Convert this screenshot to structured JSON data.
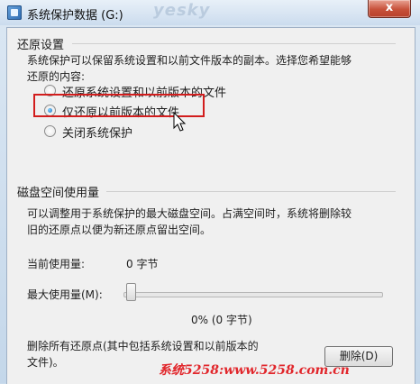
{
  "window": {
    "title": "系统保护数据 (G:)",
    "watermark": "yesky",
    "close_label": "x"
  },
  "restore_settings": {
    "heading": "还原设置",
    "description_lines": [
      "系统保护可以保留系统设置和以前文件版本的副本。选择您希望能够",
      "还原的内容:"
    ],
    "options": [
      {
        "label": "还原系统设置和以前版本的文件",
        "checked": false
      },
      {
        "label": "仅还原以前版本的文件",
        "checked": true
      },
      {
        "label": "关闭系统保护",
        "checked": false
      }
    ]
  },
  "disk_usage": {
    "heading": "磁盘空间使用量",
    "description_lines": [
      "可以调整用于系统保护的最大磁盘空间。占满空间时，系统将删除较",
      "旧的还原点以便为新还原点留出空间。"
    ],
    "current_usage_label": "当前使用量:",
    "current_usage_value": "0 字节",
    "max_usage_label": "最大使用量(M):",
    "slider_value_percent": 0,
    "slider_value_text": "0% (0 字节)",
    "delete_text_lines": [
      "删除所有还原点(其中包括系统设置和以前版本的",
      "文件)。"
    ],
    "delete_button_label": "删除(D)"
  },
  "footer_watermark": "系统5258:www.5258.com.cn",
  "colors": {
    "highlight": "#d21d1d",
    "watermark_red": "#e1262b",
    "close_button": "#c7513a"
  }
}
